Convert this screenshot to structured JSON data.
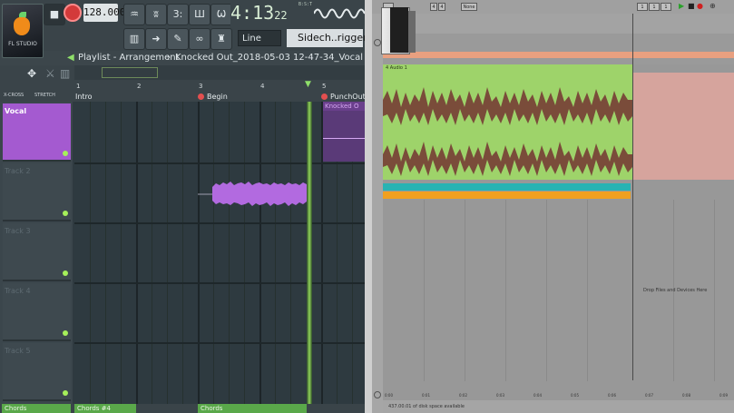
{
  "fl": {
    "tempo": "128.000",
    "time_main": "4:13",
    "time_sub": "22",
    "time_label": "B:S:T",
    "snap": "Line",
    "channel": "Sidech..rigger",
    "logo_text": "FL STUDIO",
    "title": "Playlist - Arrangement",
    "breadcrumb": "Knocked Out_2018-05-03 12-47-34_Vocal",
    "ruler": [
      "1",
      "2",
      "3",
      "4",
      "5"
    ],
    "markers": {
      "intro": "Intro",
      "begin": "Begin",
      "punchout": "PunchOut #",
      "knocked": "Knocked O"
    },
    "xcross": "X-CROSS",
    "stretch": "STRETCH",
    "tracks": [
      "Vocal",
      "Track 2",
      "Track 3",
      "Track 4",
      "Track 5"
    ],
    "bottom": {
      "chords_a": "Chords",
      "chords_b": "Chords #4",
      "chords_c": "Chords"
    },
    "colors": {
      "vocal": "#a45ad0",
      "wave": "#b26ae0",
      "playhead": "#90d35a"
    }
  },
  "ab": {
    "transport_values": [
      "1",
      "1",
      "1"
    ],
    "meter": [
      "4",
      "4"
    ],
    "mode": "None",
    "track_label": "4 Audio 1",
    "drop_text": "Drop Files and Devices Here",
    "status": "437.00.01 of disk space available",
    "times": [
      "0:00",
      "0:01",
      "0:02",
      "0:03",
      "0:04",
      "0:05",
      "0:06",
      "0:07",
      "0:08",
      "0:09"
    ],
    "colors": {
      "clip": "#9ed36a",
      "wave": "#7a4c3a",
      "cyan": "#28b3b3",
      "orange": "#f0a020"
    }
  }
}
